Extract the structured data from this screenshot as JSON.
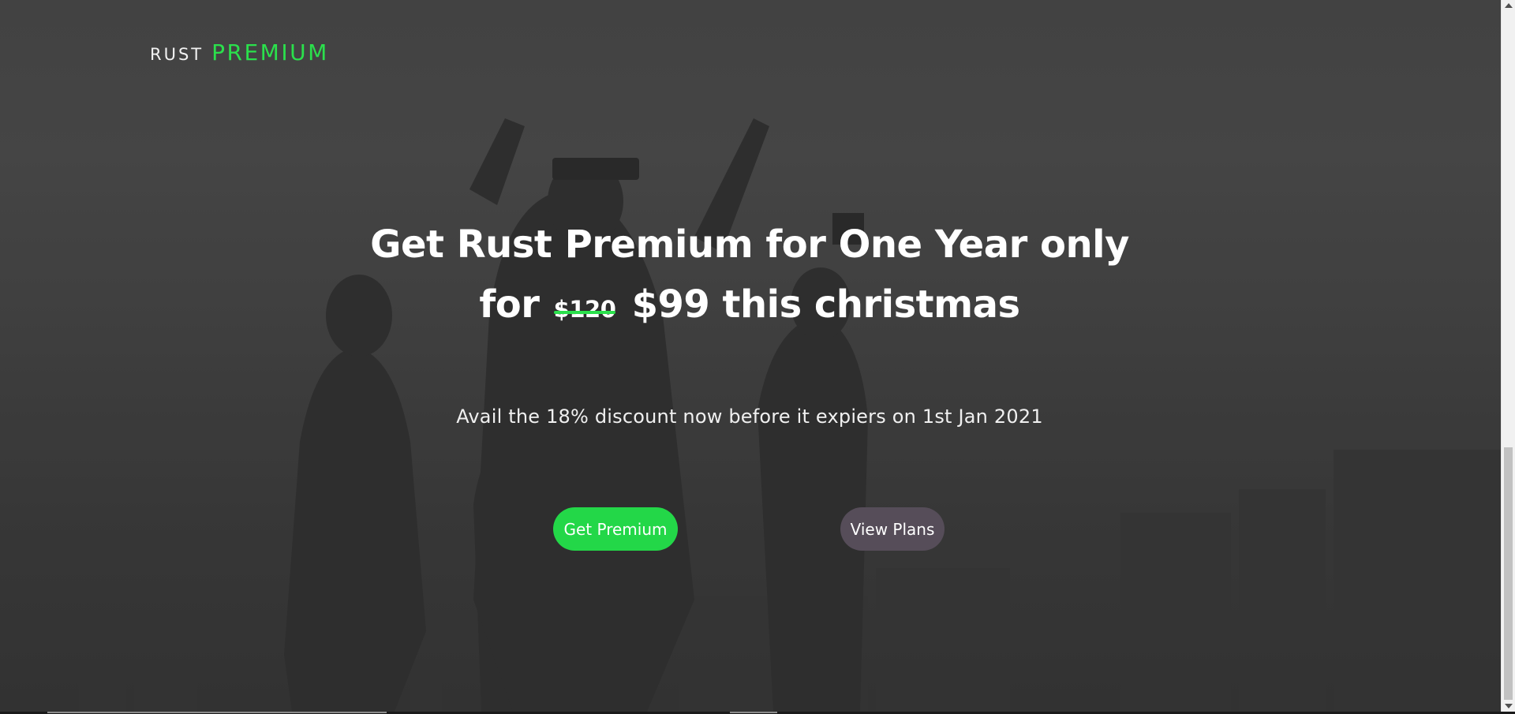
{
  "brand": {
    "prefix": "RUST",
    "name": "PREMIUM"
  },
  "hero": {
    "headline_line1": "Get Rust Premium for One Year only",
    "headline_for": "for",
    "old_price": "$120",
    "new_price_text": "$99 this christmas",
    "subtext": "Avail the 18% discount now before it expiers on 1st Jan 2021"
  },
  "buttons": {
    "get_premium": "Get Premium",
    "view_plans": "View Plans"
  },
  "colors": {
    "accent": "#2be04c",
    "primary_button": "#23d748",
    "secondary_button": "#564d59",
    "text": "#ffffff"
  }
}
